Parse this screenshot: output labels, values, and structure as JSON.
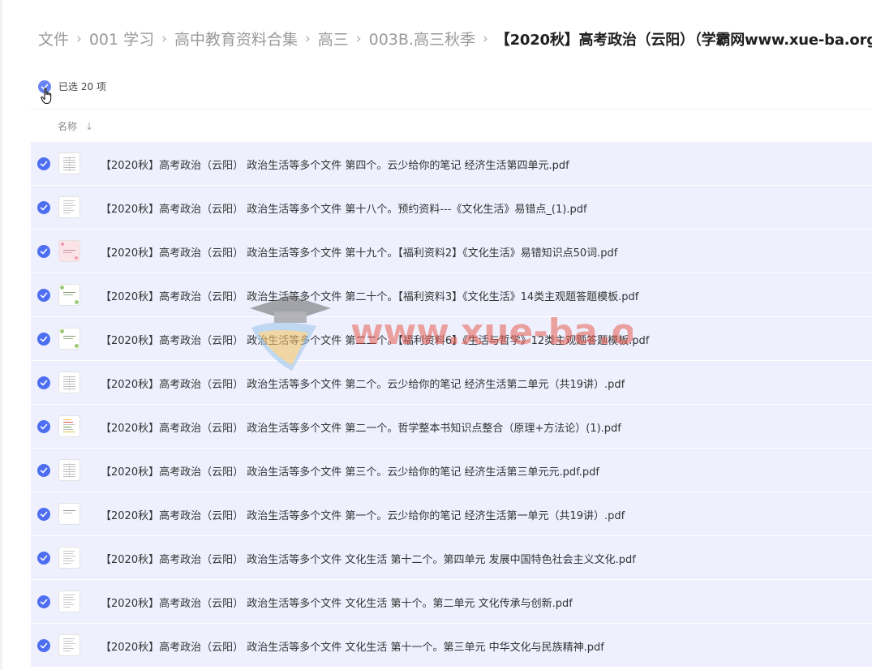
{
  "breadcrumb": {
    "items": [
      "文件",
      "001 学习",
      "高中教育资料合集",
      "高三",
      "003B.高三秋季"
    ],
    "current": "【2020秋】高考政治（云阳）（学霸网www.xue-ba.org)"
  },
  "selection": {
    "label": "已选 20 项"
  },
  "column_header": {
    "name": "名称",
    "sort_icon": "arrow-down-icon"
  },
  "files": [
    {
      "name": "【2020秋】高考政治（云阳） 政治生活等多个文件 第四个。云少给你的笔记 经济生活第四单元.pdf",
      "thumb": "table"
    },
    {
      "name": "【2020秋】高考政治（云阳） 政治生活等多个文件 第十八个。预约资料---《文化生活》易错点_(1).pdf",
      "thumb": "text"
    },
    {
      "name": "【2020秋】高考政治（云阳） 政治生活等多个文件 第十九个。【福利资料2】《文化生活》易错知识点50词.pdf",
      "thumb": "pink"
    },
    {
      "name": "【2020秋】高考政治（云阳） 政治生活等多个文件 第二十个。【福利资料3】《文化生活》14类主观题答题模板.pdf",
      "thumb": "green"
    },
    {
      "name": "【2020秋】高考政治（云阳） 政治生活等多个文件 第二二个。【福利资料6】《生活与哲学》12类主观题答题模板.pdf",
      "thumb": "green"
    },
    {
      "name": "【2020秋】高考政治（云阳） 政治生活等多个文件 第二个。云少给你的笔记 经济生活第二单元（共19讲）.pdf",
      "thumb": "table"
    },
    {
      "name": "【2020秋】高考政治（云阳） 政治生活等多个文件 第二一个。哲学整本书知识点整合（原理+方法论）(1).pdf",
      "thumb": "color"
    },
    {
      "name": "【2020秋】高考政治（云阳） 政治生活等多个文件 第三个。云少给你的笔记 经济生活第三单元元.pdf.pdf",
      "thumb": "table"
    },
    {
      "name": "【2020秋】高考政治（云阳） 政治生活等多个文件 第一个。云少给你的笔记 经济生活第一单元（共19讲）.pdf",
      "thumb": "title"
    },
    {
      "name": "【2020秋】高考政治（云阳） 政治生活等多个文件 文化生活 第十二个。第四单元 发展中国特色社会主义文化.pdf",
      "thumb": "text"
    },
    {
      "name": "【2020秋】高考政治（云阳） 政治生活等多个文件 文化生活 第十个。第二单元 文化传承与创新.pdf",
      "thumb": "text"
    },
    {
      "name": "【2020秋】高考政治（云阳） 政治生活等多个文件 文化生活 第十一个。第三单元 中华文化与民族精神.pdf",
      "thumb": "text"
    }
  ],
  "watermark": {
    "text": "www.xue-ba.org"
  },
  "colors": {
    "accent": "#4e6ef2",
    "row_selected_bg": "#eef0fe",
    "watermark_text": "#e8584a"
  }
}
